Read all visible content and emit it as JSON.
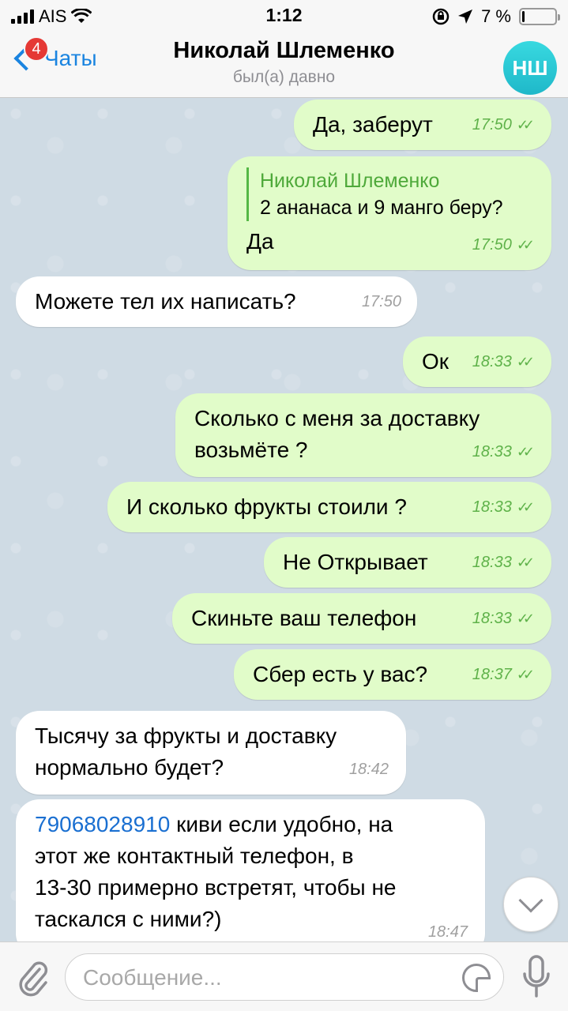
{
  "status_bar": {
    "carrier": "AIS",
    "time": "1:12",
    "battery_percent": "7 %",
    "battery_level": 0.07
  },
  "header": {
    "back_label": "Чаты",
    "unread_badge": "4",
    "title": "Николай Шлеменко",
    "subtitle": "был(а) давно",
    "avatar_initials": "НШ",
    "avatar_color": "#2cc8d6"
  },
  "messages": [
    {
      "dir": "out",
      "text": "Да, заберут",
      "time": "17:50",
      "read": true
    },
    {
      "dir": "out",
      "reply_to": {
        "name": "Николай Шлеменко",
        "text": "2 ананаса и 9 манго беру?"
      },
      "text": "Да",
      "time": "17:50",
      "read": true
    },
    {
      "dir": "in",
      "text": "Можете тел их написать?",
      "time": "17:50"
    },
    {
      "dir": "out",
      "text": "Ок",
      "time": "18:33",
      "read": true
    },
    {
      "dir": "out",
      "text_line1": "Сколько с меня за доставку",
      "text_line2": "возьмёте ?",
      "time": "18:33",
      "read": true
    },
    {
      "dir": "out",
      "text": "И сколько фрукты стоили ?",
      "time": "18:33",
      "read": true
    },
    {
      "dir": "out",
      "text": "Не Открывает",
      "time": "18:33",
      "read": true
    },
    {
      "dir": "out",
      "text": "Скиньте ваш телефон",
      "time": "18:33",
      "read": true
    },
    {
      "dir": "out",
      "text": "Сбер есть у вас?",
      "time": "18:37",
      "read": true
    },
    {
      "dir": "in",
      "text_line1": "Тысячу за фрукты и доставку",
      "text_line2": "нормально будет?",
      "time": "18:42"
    },
    {
      "dir": "in",
      "phone": "79068028910",
      "text_line1_rest": " киви если удобно, на",
      "text_line2": "этот же контактный телефон, в",
      "text_line3": "13-30 примерно встретят, чтобы не",
      "text_line4": "таскался с ними?)",
      "time": "18:47"
    }
  ],
  "input": {
    "placeholder": "Сообщение..."
  },
  "colors": {
    "outgoing_bubble": "#e1fcc9",
    "incoming_bubble": "#ffffff",
    "accent": "#1a84e0",
    "read_check": "#5fb24a"
  }
}
